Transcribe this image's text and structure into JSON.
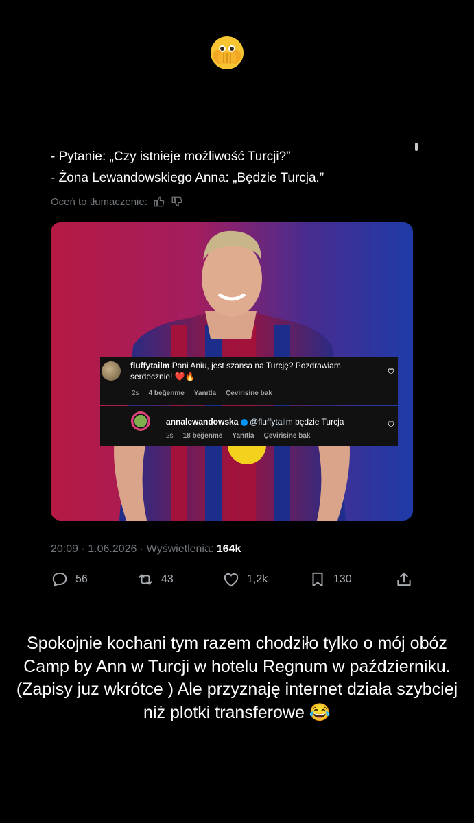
{
  "tweet": {
    "line1": "- Pytanie: „Czy istnieje możliwość Turcji?”",
    "line2": "- Żona Lewandowskiego Anna: „Będzie Turcja.”",
    "rate_label": "Oceń to tłumaczenie:",
    "time": "20:09 · 1.06.2026 · Wyświetlenia:",
    "views": "164k",
    "replies": "56",
    "retweets": "43",
    "likes": "1,2k",
    "bookmarks": "130"
  },
  "comments": [
    {
      "user": "fluffytailm",
      "text_line1": "Pani Aniu, jest szansa na Turcję? Pozdrawiam",
      "text_line2": "serdecznie! ❤️🔥",
      "age": "2s",
      "likes": "4 beğenme",
      "reply": "Yanıtla",
      "translate": "Çevirisine bak"
    },
    {
      "user": "annalewandowska",
      "mention": "@fluffytailm",
      "text": "będzie Turcja",
      "age": "2s",
      "likes": "18 beğenme",
      "reply": "Yanıtla",
      "translate": "Çevirisine bak"
    }
  ],
  "story_caption": "Spokojnie kochani tym razem chodziło tylko o mój obóz Camp by Ann w Turcji w hotelu Regnum w październiku. (Zapisy juz wkrótce ) Ale przyznaję internet działa szybciej niż plotki transferowe 😂",
  "colors": {
    "background": "#000000",
    "muted": "#71767b",
    "verified": "#0095f6"
  }
}
